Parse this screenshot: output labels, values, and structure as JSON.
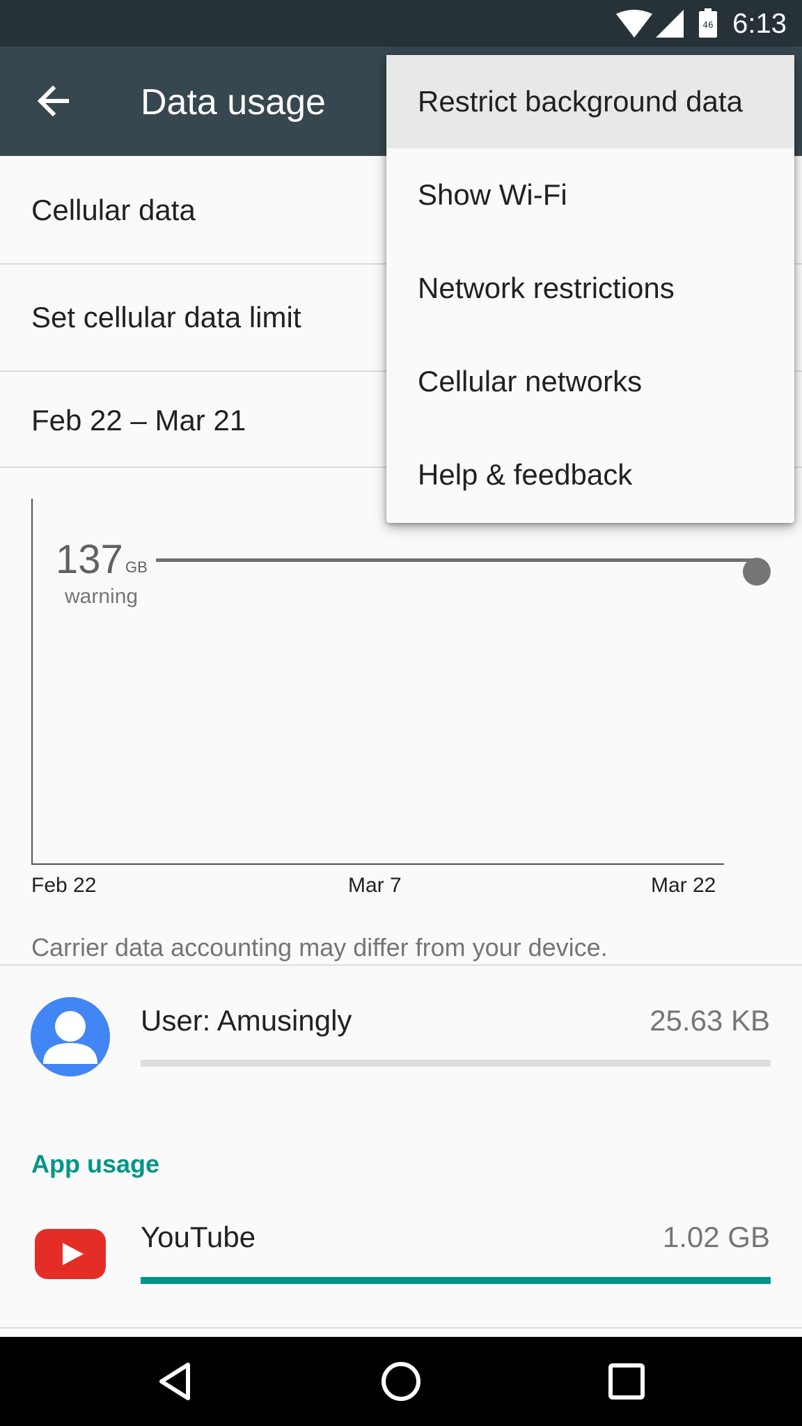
{
  "status_bar": {
    "time": "6:13",
    "battery_text": "46",
    "icons": [
      "wifi-icon",
      "cell-signal-icon",
      "battery-icon"
    ]
  },
  "app_bar": {
    "title": "Data usage",
    "back_icon": "arrow-back-icon"
  },
  "settings": [
    {
      "label": "Cellular data"
    },
    {
      "label": "Set cellular data limit"
    },
    {
      "label": "Feb 22 – Mar 21"
    }
  ],
  "chart": {
    "warning_value": "137",
    "warning_unit": "GB",
    "warning_label": "warning",
    "x_ticks": [
      "Feb 22",
      "Mar 7",
      "Mar 22"
    ]
  },
  "note": "Carrier data accounting may differ from your device.",
  "user": {
    "name": "User: Amusingly",
    "usage": "25.63 KB",
    "usage_fraction": 0.0
  },
  "app_usage": {
    "heading": "App usage",
    "apps": [
      {
        "name": "YouTube",
        "usage": "1.02 GB",
        "usage_fraction": 1.0,
        "icon": "youtube-icon"
      }
    ]
  },
  "overflow_menu": {
    "items": [
      {
        "label": "Restrict background data",
        "highlighted": true
      },
      {
        "label": "Show Wi-Fi"
      },
      {
        "label": "Network restrictions"
      },
      {
        "label": "Cellular networks"
      },
      {
        "label": "Help & feedback"
      }
    ]
  },
  "nav_bar": {
    "buttons": [
      "back-nav-icon",
      "home-nav-icon",
      "recents-nav-icon"
    ]
  },
  "colors": {
    "app_bar": "#37474f",
    "status_bar": "#263238",
    "accent": "#009688",
    "avatar": "#4285f4",
    "youtube_red": "#e52d27"
  }
}
